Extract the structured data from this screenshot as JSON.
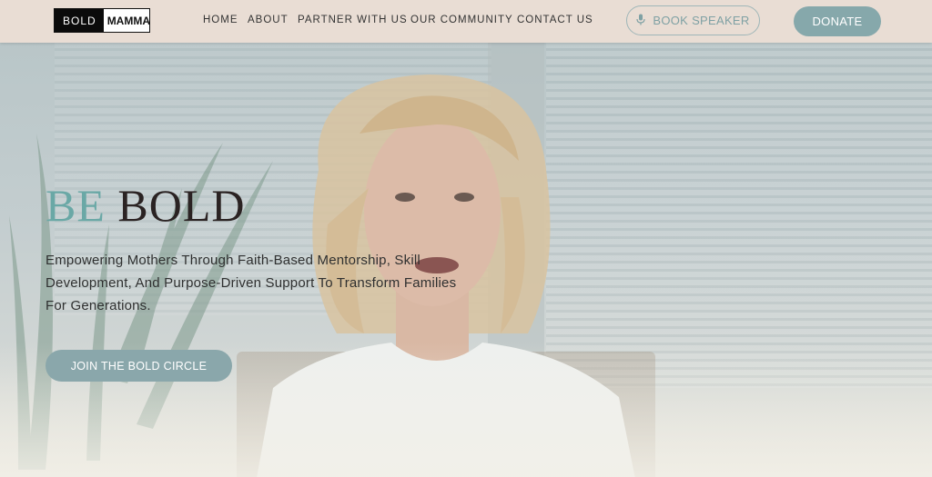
{
  "header": {
    "logo": {
      "part1": "BOLD",
      "part2": "MAMMAS"
    },
    "nav": [
      {
        "label": "HOME"
      },
      {
        "label": "ABOUT"
      },
      {
        "label": "PARTNER WITH US"
      },
      {
        "label": "OUR COMMUNITY"
      },
      {
        "label": "CONTACT US"
      }
    ],
    "book_speaker": {
      "label": "BOOK SPEAKER",
      "icon": "microphone-icon"
    },
    "donate": {
      "label": "DONATE"
    }
  },
  "hero": {
    "title_accent": "BE",
    "title_main": "BOLD",
    "subtitle": "Empowering Mothers Through Faith-Based Mentorship, Skill Development, And Purpose-Driven Support To Transform Families For Generations.",
    "cta": {
      "label": "JOIN THE BOLD CIRCLE"
    }
  },
  "colors": {
    "header_bg": "#e9ddd4",
    "accent_teal": "#6aa8a6",
    "button_teal": "#86a8ab",
    "title_dark": "#2b2323"
  }
}
